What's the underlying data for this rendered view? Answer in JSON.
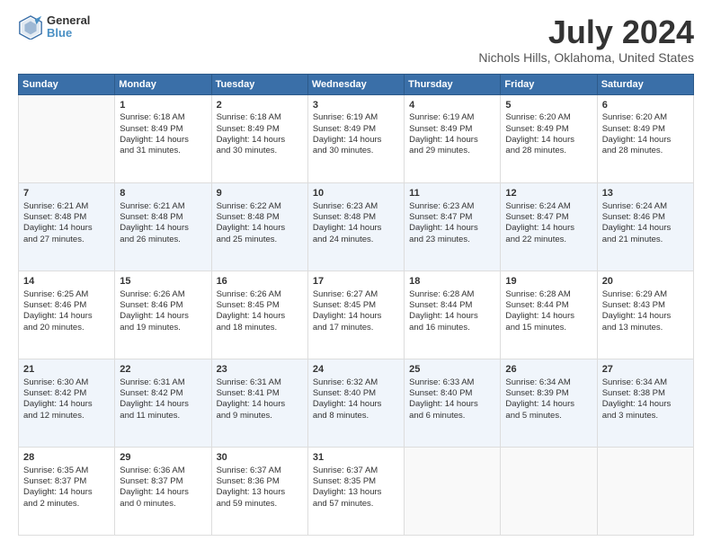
{
  "header": {
    "logo_line1": "General",
    "logo_line2": "Blue",
    "title": "July 2024",
    "subtitle": "Nichols Hills, Oklahoma, United States"
  },
  "calendar": {
    "days_of_week": [
      "Sunday",
      "Monday",
      "Tuesday",
      "Wednesday",
      "Thursday",
      "Friday",
      "Saturday"
    ],
    "weeks": [
      [
        {
          "day": "",
          "info": ""
        },
        {
          "day": "1",
          "info": "Sunrise: 6:18 AM\nSunset: 8:49 PM\nDaylight: 14 hours\nand 31 minutes."
        },
        {
          "day": "2",
          "info": "Sunrise: 6:18 AM\nSunset: 8:49 PM\nDaylight: 14 hours\nand 30 minutes."
        },
        {
          "day": "3",
          "info": "Sunrise: 6:19 AM\nSunset: 8:49 PM\nDaylight: 14 hours\nand 30 minutes."
        },
        {
          "day": "4",
          "info": "Sunrise: 6:19 AM\nSunset: 8:49 PM\nDaylight: 14 hours\nand 29 minutes."
        },
        {
          "day": "5",
          "info": "Sunrise: 6:20 AM\nSunset: 8:49 PM\nDaylight: 14 hours\nand 28 minutes."
        },
        {
          "day": "6",
          "info": "Sunrise: 6:20 AM\nSunset: 8:49 PM\nDaylight: 14 hours\nand 28 minutes."
        }
      ],
      [
        {
          "day": "7",
          "info": "Sunrise: 6:21 AM\nSunset: 8:48 PM\nDaylight: 14 hours\nand 27 minutes."
        },
        {
          "day": "8",
          "info": "Sunrise: 6:21 AM\nSunset: 8:48 PM\nDaylight: 14 hours\nand 26 minutes."
        },
        {
          "day": "9",
          "info": "Sunrise: 6:22 AM\nSunset: 8:48 PM\nDaylight: 14 hours\nand 25 minutes."
        },
        {
          "day": "10",
          "info": "Sunrise: 6:23 AM\nSunset: 8:48 PM\nDaylight: 14 hours\nand 24 minutes."
        },
        {
          "day": "11",
          "info": "Sunrise: 6:23 AM\nSunset: 8:47 PM\nDaylight: 14 hours\nand 23 minutes."
        },
        {
          "day": "12",
          "info": "Sunrise: 6:24 AM\nSunset: 8:47 PM\nDaylight: 14 hours\nand 22 minutes."
        },
        {
          "day": "13",
          "info": "Sunrise: 6:24 AM\nSunset: 8:46 PM\nDaylight: 14 hours\nand 21 minutes."
        }
      ],
      [
        {
          "day": "14",
          "info": "Sunrise: 6:25 AM\nSunset: 8:46 PM\nDaylight: 14 hours\nand 20 minutes."
        },
        {
          "day": "15",
          "info": "Sunrise: 6:26 AM\nSunset: 8:46 PM\nDaylight: 14 hours\nand 19 minutes."
        },
        {
          "day": "16",
          "info": "Sunrise: 6:26 AM\nSunset: 8:45 PM\nDaylight: 14 hours\nand 18 minutes."
        },
        {
          "day": "17",
          "info": "Sunrise: 6:27 AM\nSunset: 8:45 PM\nDaylight: 14 hours\nand 17 minutes."
        },
        {
          "day": "18",
          "info": "Sunrise: 6:28 AM\nSunset: 8:44 PM\nDaylight: 14 hours\nand 16 minutes."
        },
        {
          "day": "19",
          "info": "Sunrise: 6:28 AM\nSunset: 8:44 PM\nDaylight: 14 hours\nand 15 minutes."
        },
        {
          "day": "20",
          "info": "Sunrise: 6:29 AM\nSunset: 8:43 PM\nDaylight: 14 hours\nand 13 minutes."
        }
      ],
      [
        {
          "day": "21",
          "info": "Sunrise: 6:30 AM\nSunset: 8:42 PM\nDaylight: 14 hours\nand 12 minutes."
        },
        {
          "day": "22",
          "info": "Sunrise: 6:31 AM\nSunset: 8:42 PM\nDaylight: 14 hours\nand 11 minutes."
        },
        {
          "day": "23",
          "info": "Sunrise: 6:31 AM\nSunset: 8:41 PM\nDaylight: 14 hours\nand 9 minutes."
        },
        {
          "day": "24",
          "info": "Sunrise: 6:32 AM\nSunset: 8:40 PM\nDaylight: 14 hours\nand 8 minutes."
        },
        {
          "day": "25",
          "info": "Sunrise: 6:33 AM\nSunset: 8:40 PM\nDaylight: 14 hours\nand 6 minutes."
        },
        {
          "day": "26",
          "info": "Sunrise: 6:34 AM\nSunset: 8:39 PM\nDaylight: 14 hours\nand 5 minutes."
        },
        {
          "day": "27",
          "info": "Sunrise: 6:34 AM\nSunset: 8:38 PM\nDaylight: 14 hours\nand 3 minutes."
        }
      ],
      [
        {
          "day": "28",
          "info": "Sunrise: 6:35 AM\nSunset: 8:37 PM\nDaylight: 14 hours\nand 2 minutes."
        },
        {
          "day": "29",
          "info": "Sunrise: 6:36 AM\nSunset: 8:37 PM\nDaylight: 14 hours\nand 0 minutes."
        },
        {
          "day": "30",
          "info": "Sunrise: 6:37 AM\nSunset: 8:36 PM\nDaylight: 13 hours\nand 59 minutes."
        },
        {
          "day": "31",
          "info": "Sunrise: 6:37 AM\nSunset: 8:35 PM\nDaylight: 13 hours\nand 57 minutes."
        },
        {
          "day": "",
          "info": ""
        },
        {
          "day": "",
          "info": ""
        },
        {
          "day": "",
          "info": ""
        }
      ]
    ]
  }
}
